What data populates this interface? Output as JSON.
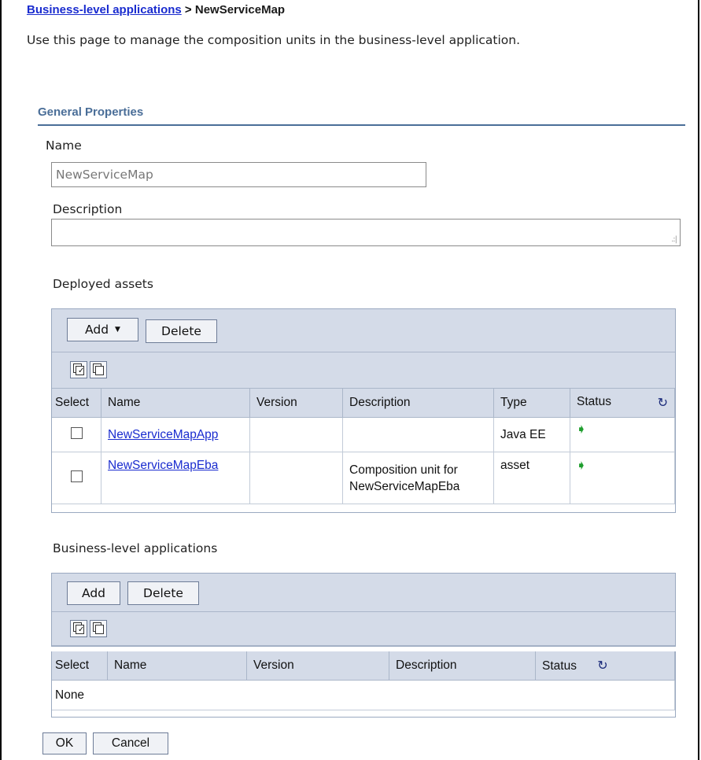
{
  "breadcrumb": {
    "link": "Business-level applications",
    "separator": " > ",
    "current": "NewServiceMap"
  },
  "intro": "Use this page to manage the composition units in the business-level application.",
  "general_properties": {
    "title": "General Properties",
    "name_label": "Name",
    "name_value": "NewServiceMap",
    "description_label": "Description",
    "description_value": ""
  },
  "deployed_assets": {
    "title": "Deployed assets",
    "add_label": "Add",
    "delete_label": "Delete",
    "columns": [
      "Select",
      "Name",
      "Version",
      "Description",
      "Type",
      "Status"
    ],
    "rows": [
      {
        "name": "NewServiceMapApp",
        "version": "",
        "description": "",
        "type": "Java EE",
        "status": "➧"
      },
      {
        "name": "NewServiceMapEba",
        "version": "",
        "description": "Composition unit for NewServiceMapEba",
        "type": "asset",
        "status": "➧"
      }
    ]
  },
  "business_apps": {
    "title": "Business-level applications",
    "add_label": "Add",
    "delete_label": "Delete",
    "columns": [
      "Select",
      "Name",
      "Version",
      "Description",
      "Status"
    ],
    "empty_text": "None"
  },
  "footer": {
    "ok_label": "OK",
    "cancel_label": "Cancel"
  },
  "icons": {
    "refresh": "refresh-icon",
    "status_started": "green-arrow-icon",
    "select_all": "select-all-icon",
    "deselect_all": "deselect-all-icon"
  },
  "colors": {
    "link": "#1a2ccf",
    "section_title": "#4a6e98",
    "table_header": "#d4dbe8",
    "status_green": "#1f9e2e"
  }
}
